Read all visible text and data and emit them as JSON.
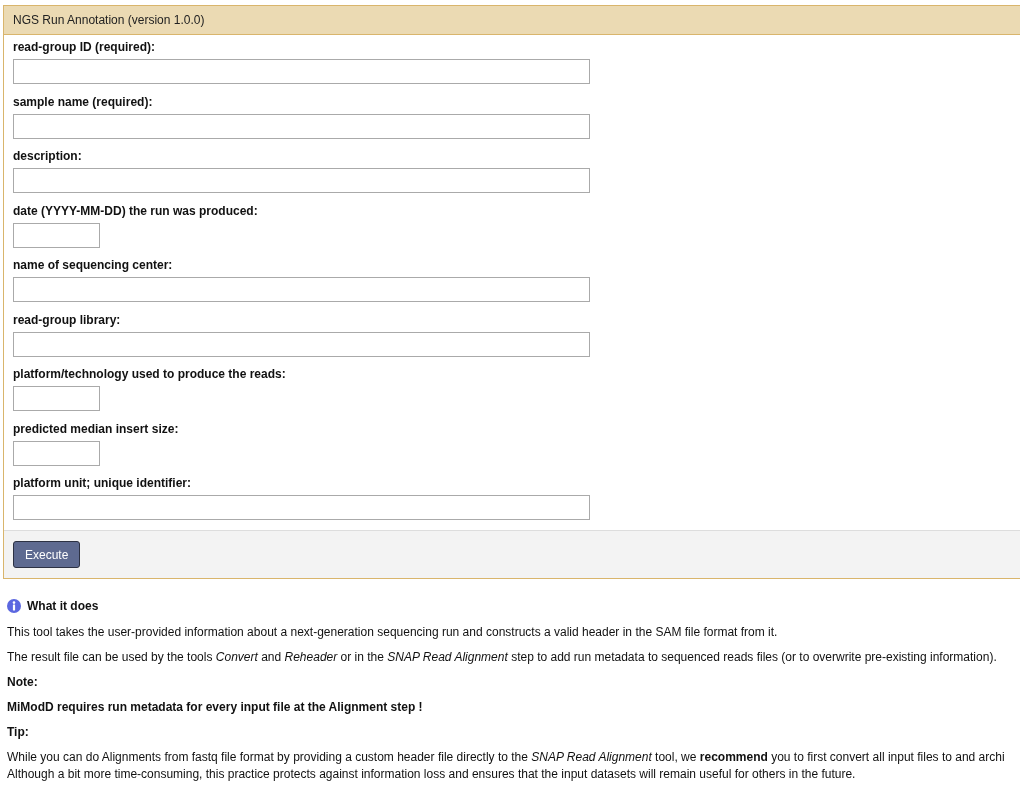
{
  "tool": {
    "title": "NGS Run Annotation (version 1.0.0)",
    "fields": [
      {
        "label": "read-group ID (required):",
        "kind": "long"
      },
      {
        "label": "sample name (required):",
        "kind": "long"
      },
      {
        "label": "description:",
        "kind": "long"
      },
      {
        "label": "date (YYYY-MM-DD) the run was produced:",
        "kind": "short"
      },
      {
        "label": "name of sequencing center:",
        "kind": "long"
      },
      {
        "label": "read-group library:",
        "kind": "long"
      },
      {
        "label": "platform/technology used to produce the reads:",
        "kind": "short"
      },
      {
        "label": "predicted median insert size:",
        "kind": "short"
      },
      {
        "label": "platform unit; unique identifier:",
        "kind": "long"
      }
    ],
    "execute_button": "Execute"
  },
  "help": {
    "heading": "What it does",
    "blocks": [
      {
        "kind": "plain",
        "lines": [
          "This tool takes the user-provided information about a next-generation sequencing run and constructs a valid header in the SAM file format from it."
        ]
      },
      {
        "kind": "plain",
        "lines": [
          "The result file can be used by the tools *Convert* and *Reheader* or in the *SNAP Read Alignment* step to add run metadata to sequenced reads files (or to overwrite pre-existing information)."
        ]
      },
      {
        "kind": "bold",
        "lines": [
          "Note:"
        ]
      },
      {
        "kind": "bold",
        "lines": [
          "MiModD requires run metadata for every input file at the Alignment step !"
        ]
      },
      {
        "kind": "bold",
        "lines": [
          "Tip:"
        ]
      },
      {
        "kind": "plain",
        "lines": [
          "While you can do Alignments from fastq file format by providing a custom header file directly to the *SNAP Read Alignment* tool, we **recommend** you to first convert all input files to and archi",
          "Although a bit more time-consuming, this practice protects against information loss and ensures that the input datasets will remain useful for others in the future."
        ]
      }
    ]
  }
}
